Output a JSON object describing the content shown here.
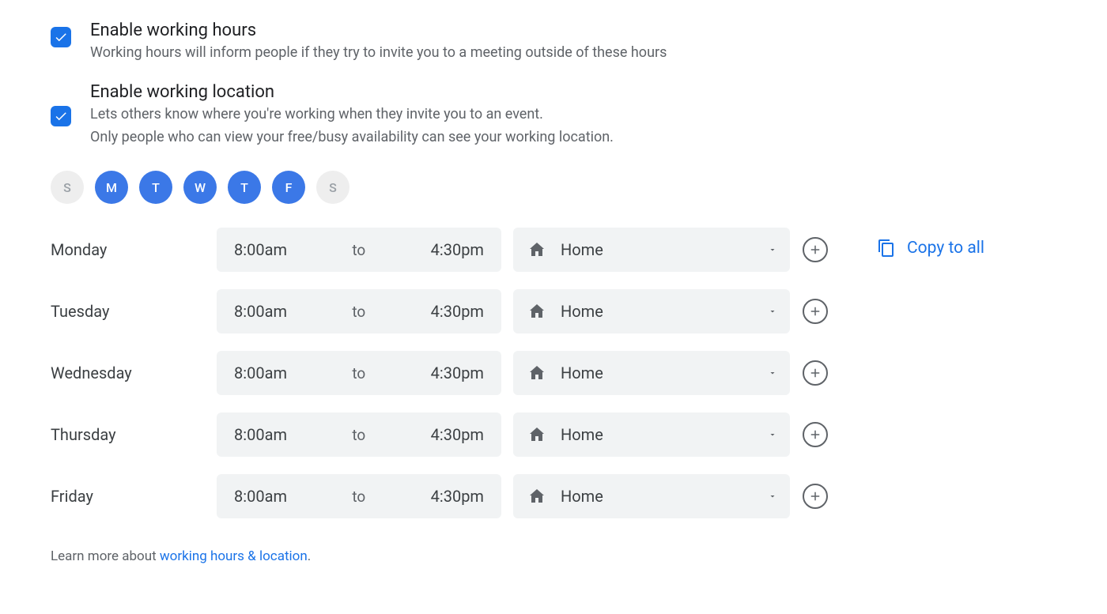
{
  "settings": {
    "working_hours": {
      "enabled": true,
      "title": "Enable working hours",
      "desc": "Working hours will inform people if they try to invite you to a meeting outside of these hours"
    },
    "working_location": {
      "enabled": true,
      "title": "Enable working location",
      "desc1": "Lets others know where you're working when they invite you to an event.",
      "desc2": "Only people who can view your free/busy availability can see your working location."
    }
  },
  "days_of_week": [
    {
      "label": "S",
      "selected": false
    },
    {
      "label": "M",
      "selected": true
    },
    {
      "label": "T",
      "selected": true
    },
    {
      "label": "W",
      "selected": true
    },
    {
      "label": "T",
      "selected": true
    },
    {
      "label": "F",
      "selected": true
    },
    {
      "label": "S",
      "selected": false
    }
  ],
  "time_separator": "to",
  "schedule": [
    {
      "day": "Monday",
      "start": "8:00am",
      "end": "4:30pm",
      "location": "Home"
    },
    {
      "day": "Tuesday",
      "start": "8:00am",
      "end": "4:30pm",
      "location": "Home"
    },
    {
      "day": "Wednesday",
      "start": "8:00am",
      "end": "4:30pm",
      "location": "Home"
    },
    {
      "day": "Thursday",
      "start": "8:00am",
      "end": "4:30pm",
      "location": "Home"
    },
    {
      "day": "Friday",
      "start": "8:00am",
      "end": "4:30pm",
      "location": "Home"
    }
  ],
  "copy_to_all_label": "Copy to all",
  "learn_more": {
    "prefix": "Learn more about ",
    "link_text": "working hours & location",
    "suffix": "."
  }
}
